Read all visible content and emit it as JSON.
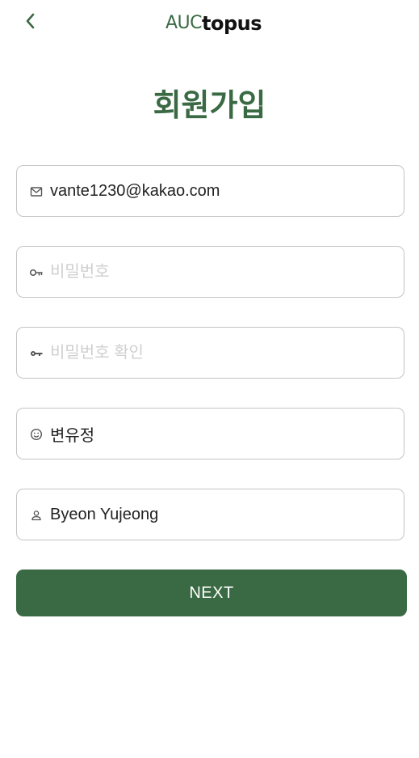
{
  "header": {
    "back_icon": "chevron-left-icon",
    "logo_part_a": "AUC",
    "logo_part_b": "topus"
  },
  "title": "회원가입",
  "form": {
    "email": {
      "icon": "mail-icon",
      "value": "vante1230@kakao.com",
      "placeholder": ""
    },
    "password": {
      "icon": "key-icon",
      "value": "",
      "placeholder": "비밀번호"
    },
    "password_confirm": {
      "icon": "key-icon",
      "value": "",
      "placeholder": "비밀번호 확인"
    },
    "nickname": {
      "icon": "smile-icon",
      "value": "변유정",
      "placeholder": ""
    },
    "name": {
      "icon": "person-icon",
      "value": "Byeon Yujeong",
      "placeholder": ""
    }
  },
  "next_button": {
    "label": "NEXT"
  },
  "colors": {
    "brand": "#3a6a43",
    "border": "#c4c4c4",
    "placeholder": "#cfcfcf"
  }
}
